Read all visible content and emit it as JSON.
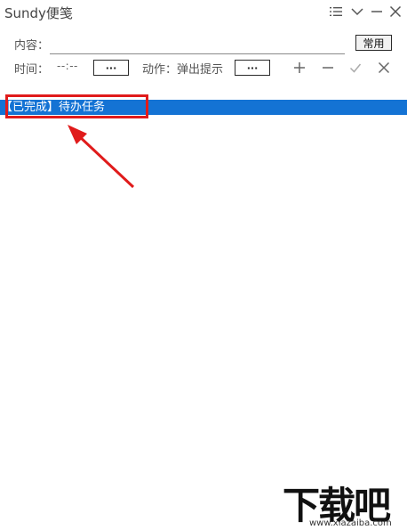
{
  "window": {
    "title": "Sundy便笺"
  },
  "titlebar": {
    "buttons": [
      {
        "icon": "list-icon"
      },
      {
        "icon": "chevron-down-icon"
      },
      {
        "icon": "minimize-icon"
      },
      {
        "icon": "close-icon"
      }
    ]
  },
  "form": {
    "content_label": "内容：",
    "content_value": "",
    "common_button_label": "常用",
    "time_label": "时间：",
    "time_value": "--:--",
    "time_picker_label": "···",
    "action_label": "动作：弹出提示",
    "action_picker_label": "···"
  },
  "actions": [
    {
      "icon": "plus-icon"
    },
    {
      "icon": "minus-icon"
    },
    {
      "icon": "check-icon"
    },
    {
      "icon": "x-icon"
    }
  ],
  "tasks": [
    {
      "text": "【已完成】待办任务",
      "selected": true
    }
  ],
  "colors": {
    "selection": "#1473d4",
    "annotation": "#e01b1b"
  },
  "watermark": {
    "logo_text": "下载吧",
    "url": "www.xiazaiba.com"
  }
}
